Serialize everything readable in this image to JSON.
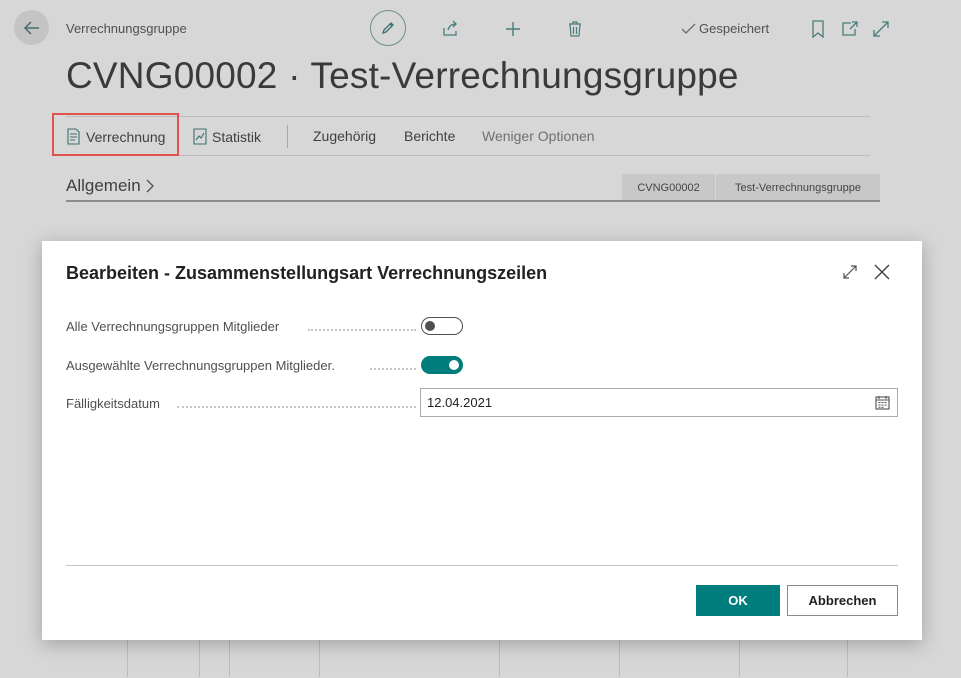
{
  "page": {
    "breadcrumb": "Verrechnungsgruppe",
    "saved_status": "Gespeichert",
    "title": "CVNG00002 · Test-Verrechnungsgruppe",
    "actions": {
      "verrechnung": "Verrechnung",
      "statistik": "Statistik",
      "zugehoerig": "Zugehörig",
      "berichte": "Berichte",
      "weniger_optionen": "Weniger Optionen"
    },
    "section": {
      "title": "Allgemein",
      "chips": [
        "CVNG00002",
        "Test-Verrechnungsgruppe"
      ]
    }
  },
  "dialog": {
    "title": "Bearbeiten - Zusammenstellungsart Verrechnungszeilen",
    "fields": {
      "alle": {
        "label": "Alle Verrechnungsgruppen Mitglieder",
        "value": false
      },
      "ausgewaehlte": {
        "label": "Ausgewählte Verrechnungsgruppen Mitglieder.",
        "value": true
      },
      "datum": {
        "label": "Fälligkeitsdatum",
        "value": "12.04.2021"
      }
    },
    "ok_label": "OK",
    "cancel_label": "Abbrechen"
  },
  "colors": {
    "accent": "#007d7d",
    "highlight": "#e0534c",
    "overlay_background": "#d7d7d7"
  },
  "icons": [
    "back-arrow-icon",
    "pencil-icon",
    "share-icon",
    "plus-icon",
    "trash-icon",
    "checkmark-icon",
    "bookmark-icon",
    "open-new-window-icon",
    "expand-icon",
    "calculation-doc-icon",
    "statistics-icon",
    "chevron-right-icon",
    "maximize-icon",
    "close-icon",
    "calendar-icon"
  ]
}
